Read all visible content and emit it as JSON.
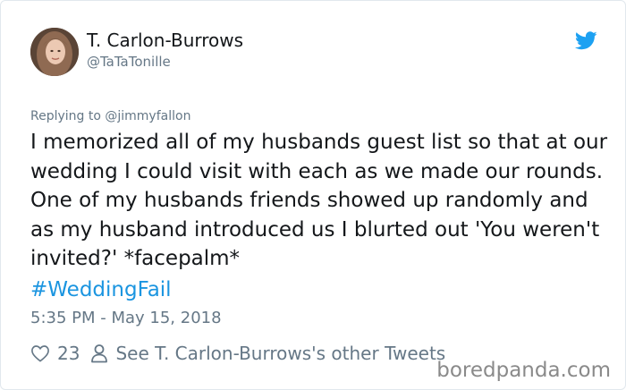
{
  "tweet": {
    "author": {
      "display_name": "T. Carlon-Burrows",
      "handle": "@TaTaTonille",
      "avatar_icon": "user-avatar-photo"
    },
    "brand_icon": "twitter-bird-icon",
    "brand_color": "#1da1f2",
    "replying_to": "Replying to @jimmyfallon",
    "text": "I memorized all of my husbands guest list so that at our wedding I could visit with each as we made our rounds. One of my husbands friends showed up randomly and as my husband introduced us I blurted out 'You weren't invited?' *facepalm*",
    "hashtag": "#WeddingFail",
    "hashtag_color": "#1b95e0",
    "timestamp": "5:35 PM - May 15, 2018",
    "actions": {
      "like_icon": "heart-icon",
      "like_count": "23",
      "profile_icon": "person-icon",
      "other_tweets_label": "See T. Carlon-Burrows's other Tweets"
    }
  },
  "watermark": "boredpanda.com"
}
